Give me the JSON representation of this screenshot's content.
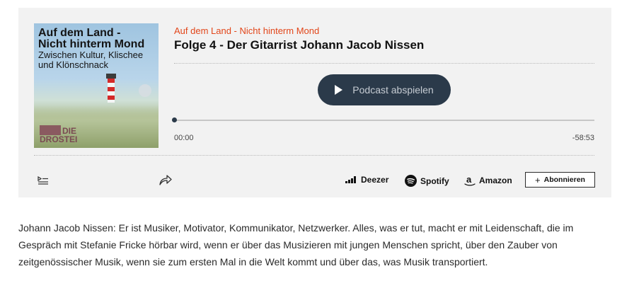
{
  "cover": {
    "title_line1": "Auf dem Land -",
    "title_line2": "Nicht hinterm Mond",
    "subtitle_line1": "Zwischen Kultur, Klischee",
    "subtitle_line2": "und Klönschnack",
    "brand_line1": "DIE",
    "brand_line2": "DROSTEI"
  },
  "player": {
    "show_title": "Auf dem Land - Nicht hinterm Mond",
    "episode_title": "Folge 4 - Der Gitarrist Johann Jacob Nissen",
    "play_label": "Podcast abspielen",
    "time_current": "00:00",
    "time_remaining": "-58:53",
    "progress": 0
  },
  "platforms": {
    "deezer": "Deezer",
    "spotify": "Spotify",
    "amazon": "Amazon"
  },
  "subscribe_label": "Abonnieren",
  "description": "Johann Jacob Nissen: Er ist Musiker, Motivator, Kommunikator, Netzwerker. Alles, was er tut, macht er mit Leidenschaft, die im Gespräch mit Stefanie Fricke hörbar wird, wenn er über das Musizieren mit jungen Menschen spricht, über den Zauber von zeitgenössischer Musik, wenn sie zum ersten Mal in die Welt kommt und über das, was Musik transportiert.",
  "colors": {
    "accent": "#e2461a",
    "play_button": "#2b3a4a",
    "panel_bg": "#f2f2f2"
  },
  "icons": [
    "playlist-icon",
    "share-icon",
    "deezer-icon",
    "spotify-icon",
    "amazon-icon",
    "play-icon",
    "plus-icon"
  ]
}
